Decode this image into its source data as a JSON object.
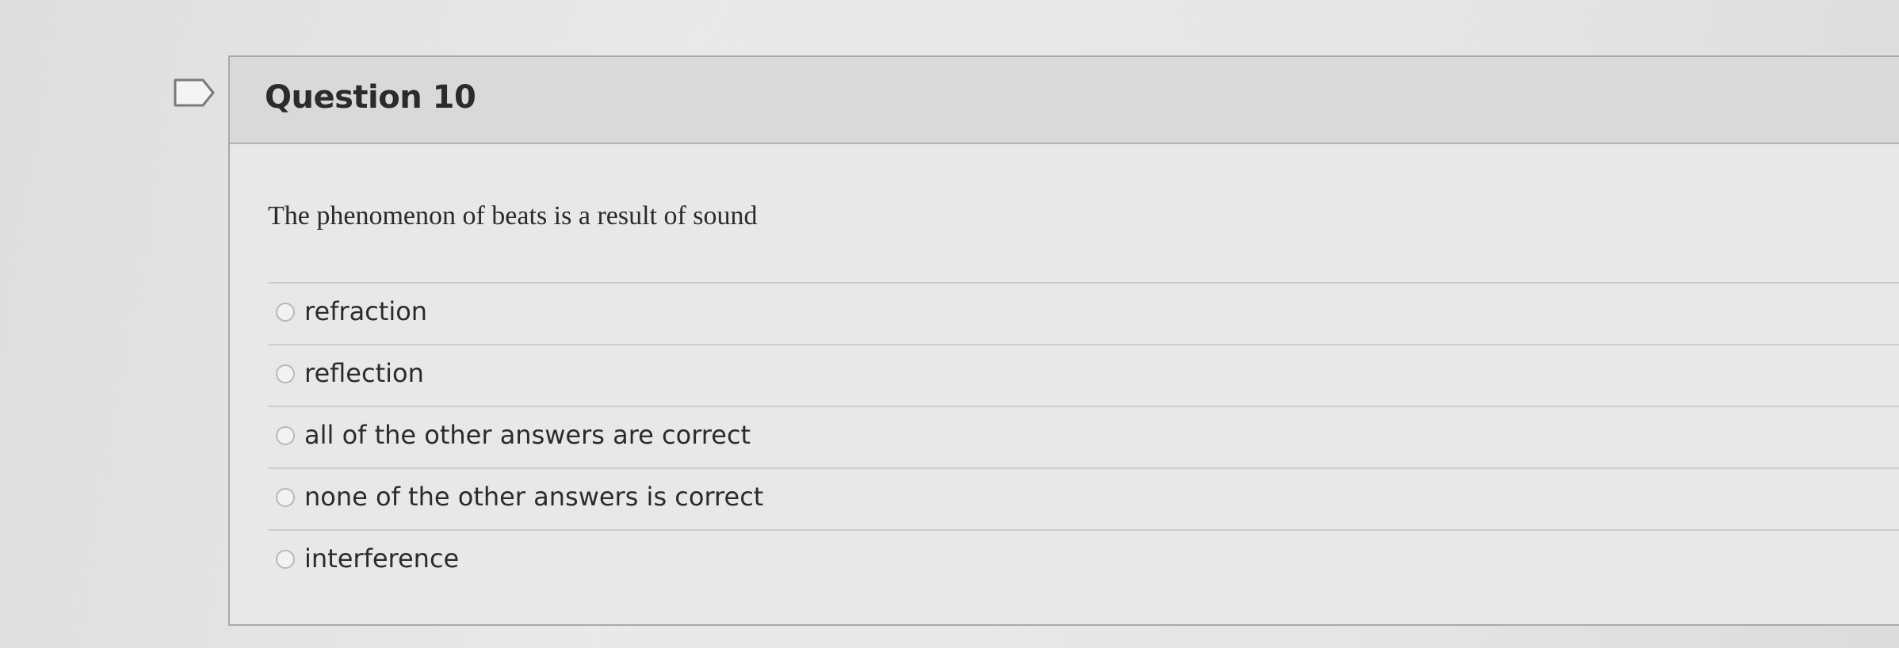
{
  "question": {
    "title": "Question 10",
    "prompt": "The phenomenon of beats is a result of sound",
    "flag_icon": "flag-icon",
    "answers": [
      {
        "label": "refraction"
      },
      {
        "label": "reflection"
      },
      {
        "label": "all of the other answers are correct"
      },
      {
        "label": "none of the other answers is correct"
      },
      {
        "label": "interference"
      }
    ]
  }
}
